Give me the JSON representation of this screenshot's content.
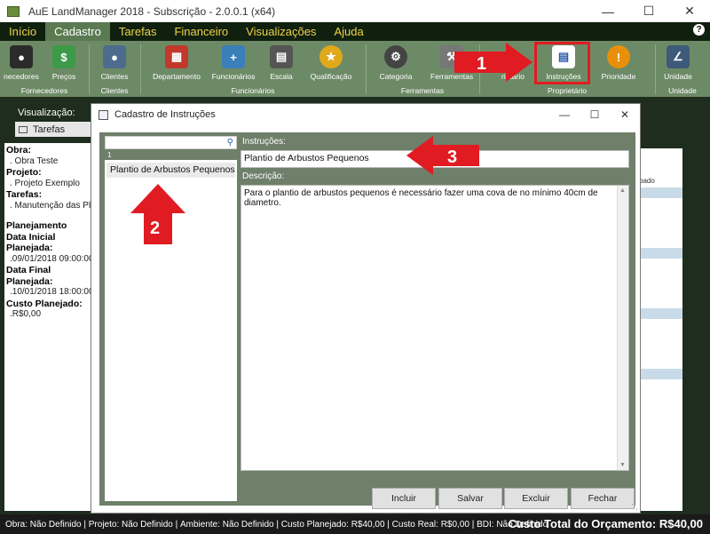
{
  "window": {
    "title": "AuE LandManager 2018  -  Subscrição - 2.0.0.1 (x64)"
  },
  "menu": {
    "items": [
      "Início",
      "Cadastro",
      "Tarefas",
      "Financeiro",
      "Visualizações",
      "Ajuda"
    ],
    "active": "Cadastro",
    "help": "?"
  },
  "ribbon": {
    "buttons": {
      "fornecedores": "necedores",
      "precos": "Preços",
      "clientes": "Clientes",
      "departamento": "Departamento",
      "funcionarios": "Funcionários",
      "escala": "Escala",
      "qualificacao": "Qualificação",
      "categoria": "Categoria",
      "ferramentas": "Ferramentas",
      "proprietario": "rietário",
      "instrucoes": "Instruções",
      "prioridade": "Prioridade",
      "unidade": "Unidade"
    },
    "groups": {
      "fornecedores": "Fornecedores",
      "clientes": "Clientes",
      "funcionarios": "Funcionários",
      "ferramentas": "Ferramentas",
      "proprietario": "Proprietário",
      "unidade": "Unidade"
    }
  },
  "main": {
    "visualizacao_label": "Visualização:",
    "tab": "Tarefas",
    "left_panel": {
      "obra_label": "Obra:",
      "obra_value": ". Obra Teste",
      "projeto_label": "Projeto:",
      "projeto_value": ". Projeto Exemplo",
      "tarefas_label": "Tarefas:",
      "tarefas_value": ". Manutenção das Pla",
      "planejamento_label": "Planejamento",
      "data_inicial_label": "Data Inicial Planejada:",
      "data_inicial_value": ".09/01/2018 09:00:00",
      "data_final_label": "Data Final Planejada:",
      "data_final_value": ".10/01/2018 18:00:00",
      "custo_label": "Custo Planejado:",
      "custo_value": ".R$0,00"
    },
    "right_panel_text": "bado"
  },
  "dialog": {
    "title": "Cadastro de Instruções",
    "search_placeholder": "",
    "list_count": "1",
    "list_items": [
      "Plantio de Arbustos Pequenos"
    ],
    "instrucoes_label": "Instruções:",
    "instrucoes_value": "Plantio de Arbustos Pequenos",
    "descricao_label": "Descrição:",
    "descricao_value": "Para o plantio de arbustos pequenos é necessário fazer uma cova de no mínimo 40cm de diametro.",
    "buttons": {
      "incluir": "Incluir",
      "salvar": "Salvar",
      "excluir": "Excluir",
      "fechar": "Fechar"
    }
  },
  "annotations": {
    "step1": "1",
    "step2": "2",
    "step3": "3",
    "color": "#e11b22"
  },
  "status": {
    "obra": "Obra: Não Definido |",
    "projeto": "Projeto: Não Definido |",
    "ambiente": "Ambiente: Não Definido |",
    "custo_planejado": "Custo Planejado: R$40,00 |",
    "custo_real": "Custo Real: R$0,00 |",
    "bdi": "BDI: Não Definido",
    "total": "Custo Total do Orçamento: R$40,00"
  }
}
